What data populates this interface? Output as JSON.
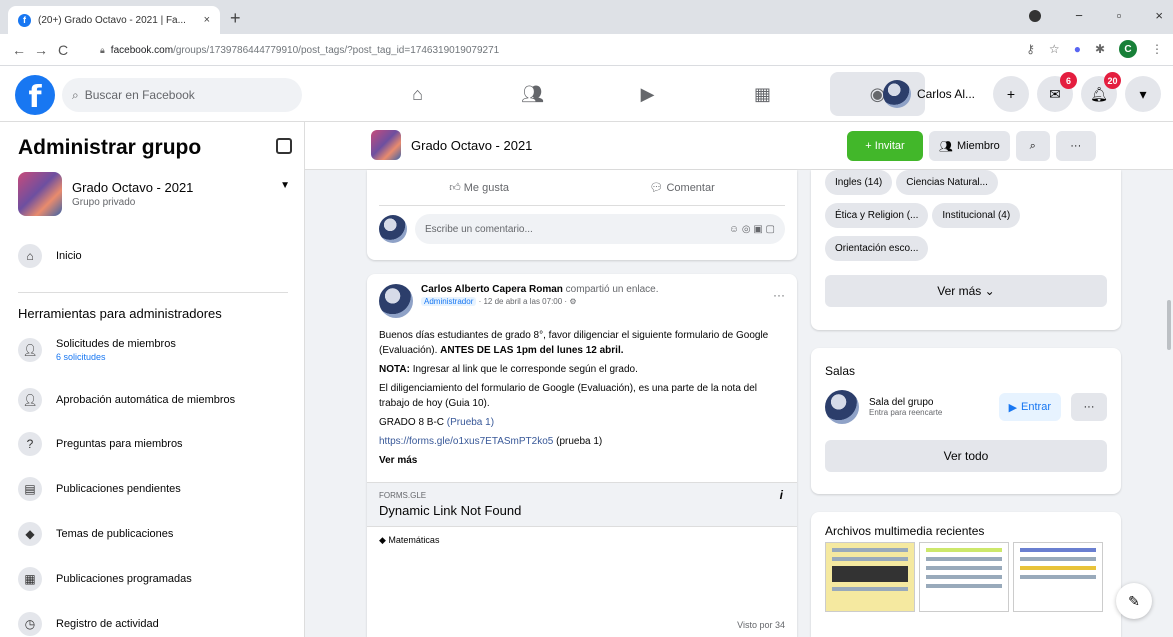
{
  "browser": {
    "tab_title": "(20+) Grado Octavo - 2021 | Fa...",
    "tab_close": "×",
    "new_tab": "+",
    "back": "←",
    "forward": "→",
    "reload": "C",
    "url_host": "facebook.com",
    "url_path": "/groups/1739786444779910/post_tags/?post_tag_id=1746319019079271",
    "win_min": "−",
    "win_max": "▫",
    "win_close": "×"
  },
  "fb": {
    "logo": "f",
    "search_placeholder": "Buscar en Facebook",
    "profile_name": "Carlos Al...",
    "messenger_badge": "6",
    "notif_badge": "20"
  },
  "left": {
    "title": "Administrar grupo",
    "group_name": "Grado Octavo - 2021",
    "group_privacy": "Grupo privado",
    "home": "Inicio",
    "tools_title": "Herramientas para administradores",
    "items": [
      {
        "label": "Solicitudes de miembros",
        "sub": "6 solicitudes"
      },
      {
        "label": "Aprobación automática de miembros"
      },
      {
        "label": "Preguntas para miembros"
      },
      {
        "label": "Publicaciones pendientes"
      },
      {
        "label": "Temas de publicaciones"
      },
      {
        "label": "Publicaciones programadas"
      },
      {
        "label": "Registro de actividad"
      }
    ]
  },
  "center": {
    "group_name": "Grado Octavo - 2021",
    "invite": "+ Invitar",
    "member": "Miembro",
    "like": "Me gusta",
    "comment": "Comentar",
    "comment_placeholder": "Escribe un comentario...",
    "post": {
      "author": "Carlos Alberto Capera Roman",
      "action": "compartió un enlace.",
      "role": "Administrador",
      "time": "12 de abril a las 07:00",
      "p1": "Buenos días estudiantes de grado 8°, favor diligenciar el siguiente formulario de Google (Evaluación).",
      "p1_bold": "ANTES DE LAS 1pm del lunes 12 abril.",
      "p2_bold": "NOTA:",
      "p2": "Ingresar al link que le corresponde según el grado.",
      "p3": "El diligenciamiento del formulario de Google (Evaluación), es una parte de la nota del trabajo de hoy (Guia 10).",
      "p4": "GRADO 8 B-C",
      "p4_tag": "(Prueba 1)",
      "link": "https://forms.gle/o1xus7ETASmPT2ko5",
      "link_tag": "(prueba 1)",
      "more": "Ver más",
      "preview_domain": "FORMS.GLE",
      "preview_title": "Dynamic Link Not Found",
      "topic": "Matemáticas",
      "seen": "Visto por 34"
    }
  },
  "right": {
    "topics": [
      "Ingles (14)",
      "Ciencias Natural...",
      "Ética y Religion (...",
      "Institucional (4)",
      "Orientación esco..."
    ],
    "see_more": "Ver más",
    "rooms_title": "Salas",
    "room_name": "Sala del grupo",
    "room_sub": "Entra para reencarte",
    "enter": "Entrar",
    "see_all": "Ver todo",
    "media_title": "Archivos multimedia recientes"
  }
}
